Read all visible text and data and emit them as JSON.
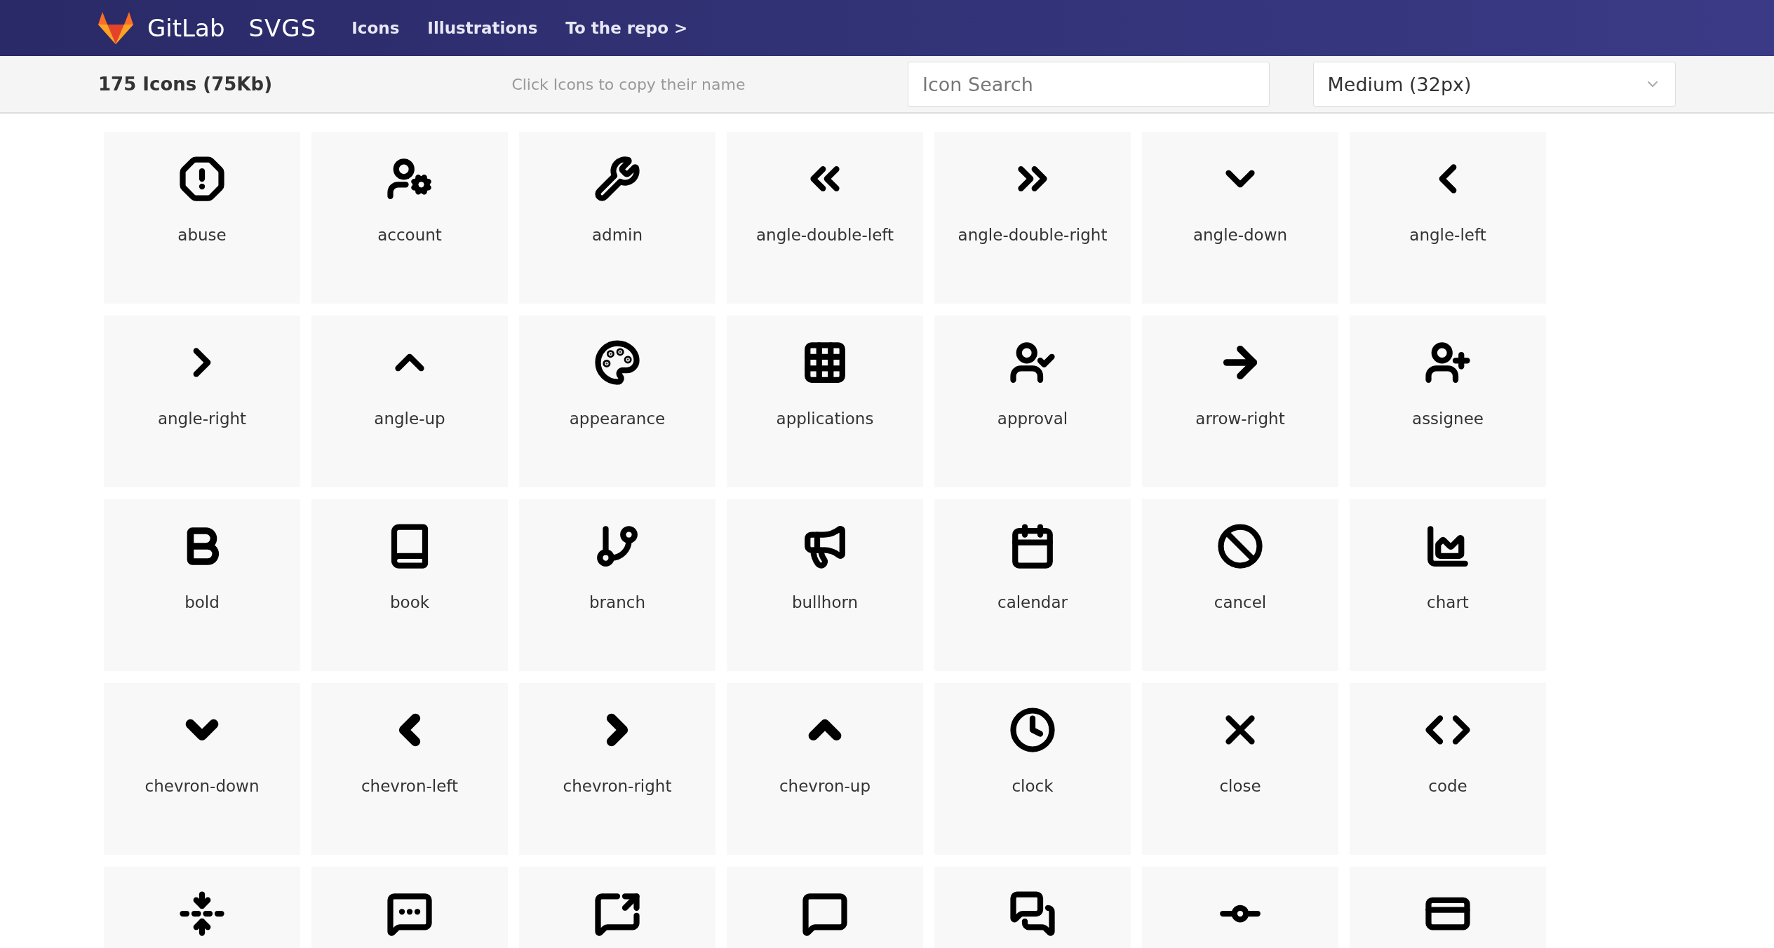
{
  "header": {
    "brand": "GitLab",
    "product": "SVGS",
    "nav": [
      {
        "label": "Icons"
      },
      {
        "label": "Illustrations"
      },
      {
        "label": "To the repo >"
      }
    ]
  },
  "toolbar": {
    "count": "175 Icons (75Kb)",
    "hint": "Click Icons to copy their name",
    "search": {
      "placeholder": "Icon Search"
    },
    "size_select": {
      "value": "Medium (32px)"
    }
  },
  "icons": [
    {
      "kind": "named",
      "label": "abuse"
    },
    {
      "kind": "named",
      "label": "account"
    },
    {
      "kind": "named",
      "label": "admin"
    },
    {
      "kind": "named",
      "label": "angle-double-left"
    },
    {
      "kind": "named",
      "label": "angle-double-right"
    },
    {
      "kind": "named",
      "label": "angle-down"
    },
    {
      "kind": "named",
      "label": "angle-left"
    },
    {
      "kind": "named",
      "label": "angle-right"
    },
    {
      "kind": "named",
      "label": "angle-up"
    },
    {
      "kind": "named",
      "label": "appearance"
    },
    {
      "kind": "named",
      "label": "applications"
    },
    {
      "kind": "named",
      "label": "approval"
    },
    {
      "kind": "named",
      "label": "arrow-right"
    },
    {
      "kind": "named",
      "label": "assignee"
    },
    {
      "kind": "named",
      "label": "bold"
    },
    {
      "kind": "named",
      "label": "book"
    },
    {
      "kind": "named",
      "label": "branch"
    },
    {
      "kind": "named",
      "label": "bullhorn"
    },
    {
      "kind": "named",
      "label": "calendar"
    },
    {
      "kind": "named",
      "label": "cancel"
    },
    {
      "kind": "named",
      "label": "chart"
    },
    {
      "kind": "named",
      "label": "chevron-down"
    },
    {
      "kind": "named",
      "label": "chevron-left"
    },
    {
      "kind": "named",
      "label": "chevron-right"
    },
    {
      "kind": "named",
      "label": "chevron-up"
    },
    {
      "kind": "named",
      "label": "clock"
    },
    {
      "kind": "named",
      "label": "close"
    },
    {
      "kind": "named",
      "label": "code"
    },
    {
      "kind": "cut"
    },
    {
      "kind": "cut"
    },
    {
      "kind": "cut"
    },
    {
      "kind": "cut"
    },
    {
      "kind": "cut"
    },
    {
      "kind": "cut"
    },
    {
      "kind": "cut"
    }
  ]
}
